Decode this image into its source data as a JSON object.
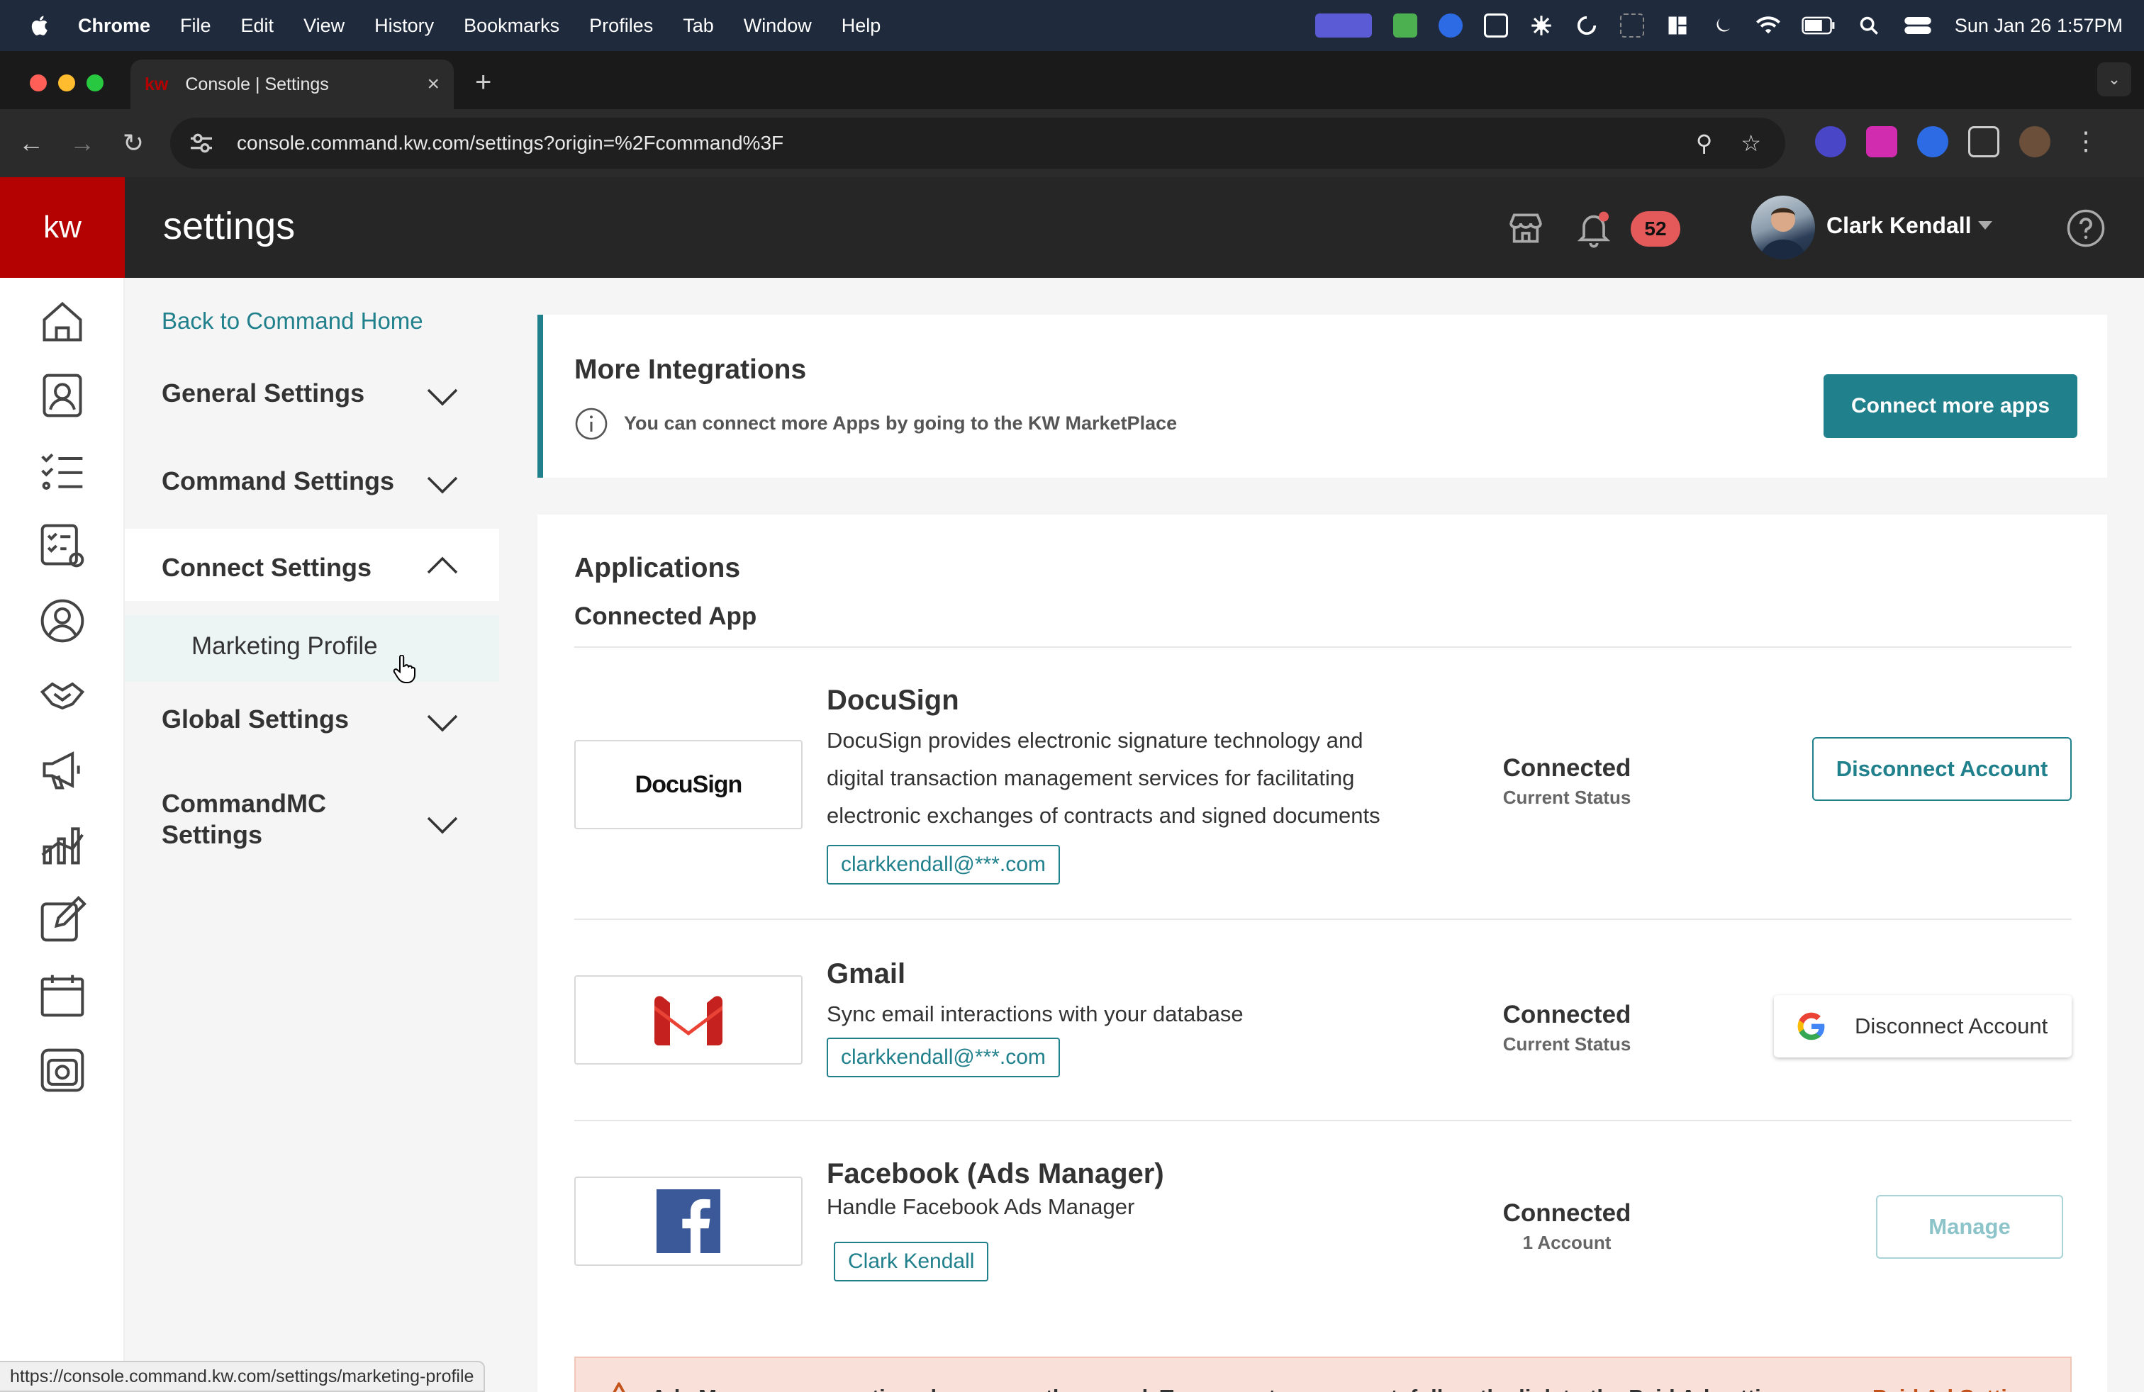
{
  "menubar": {
    "app_name": "Chrome",
    "items": [
      "File",
      "Edit",
      "View",
      "History",
      "Bookmarks",
      "Profiles",
      "Tab",
      "Window",
      "Help"
    ],
    "datetime": "Sun Jan 26  1:57PM"
  },
  "browser": {
    "tab_title": "Console | Settings",
    "tab_favicon": "kw",
    "url": "console.command.kw.com/settings?origin=%2Fcommand%3F",
    "status_url": "https://console.command.kw.com/settings/marketing-profile"
  },
  "header": {
    "logo": "kw",
    "page_title": "settings",
    "notification_count": "52",
    "user_name": "Clark Kendall"
  },
  "icon_rail": [
    "home-icon",
    "contacts-icon",
    "tasks-icon",
    "smartplans-icon",
    "profile-icon",
    "opportunities-icon",
    "marketing-icon",
    "insights-icon",
    "designs-icon",
    "calendar-icon",
    "media-icon"
  ],
  "settings_nav": {
    "back_link": "Back to Command Home",
    "sections": [
      {
        "label": "General Settings",
        "expanded": false
      },
      {
        "label": "Command Settings",
        "expanded": false
      },
      {
        "label": "Connect Settings",
        "expanded": true
      },
      {
        "label": "Global Settings",
        "expanded": false
      },
      {
        "label": "CommandMC Settings",
        "expanded": false
      }
    ],
    "sub_item": "Marketing Profile"
  },
  "integrations": {
    "title": "More Integrations",
    "description": "You can connect more Apps by going to the KW MarketPlace",
    "button": "Connect more apps"
  },
  "applications": {
    "title": "Applications",
    "subtitle": "Connected App",
    "apps": [
      {
        "name": "DocuSign",
        "logo_text": "DocuSign",
        "description": "DocuSign provides electronic signature technology and digital transaction management services for facilitating electronic exchanges of contracts and signed documents",
        "account": "clarkkendall@***.com",
        "status": "Connected",
        "status_sub": "Current Status",
        "action": "Disconnect Account"
      },
      {
        "name": "Gmail",
        "description": "Sync email interactions with your database",
        "account": "clarkkendall@***.com",
        "status": "Connected",
        "status_sub": "Current Status",
        "action": "Disconnect Account"
      },
      {
        "name": "Facebook (Ads Manager)",
        "description": "Handle Facebook Ads Manager",
        "account": "Clark Kendall",
        "status": "Connected",
        "status_sub": "1 Account",
        "action": "Manage"
      }
    ]
  },
  "alert": {
    "message": "Ads Manager connections have recently moved. To connect an account, follow the link to the Paid Ad settings.",
    "link": "Paid Ad Settings"
  },
  "colors": {
    "brand_red": "#b40101",
    "accent_teal": "#20808c",
    "header_dark": "#262626",
    "badge_red": "#e45a5a",
    "alert_bg": "#f9e1d9",
    "alert_link": "#c3531a"
  }
}
